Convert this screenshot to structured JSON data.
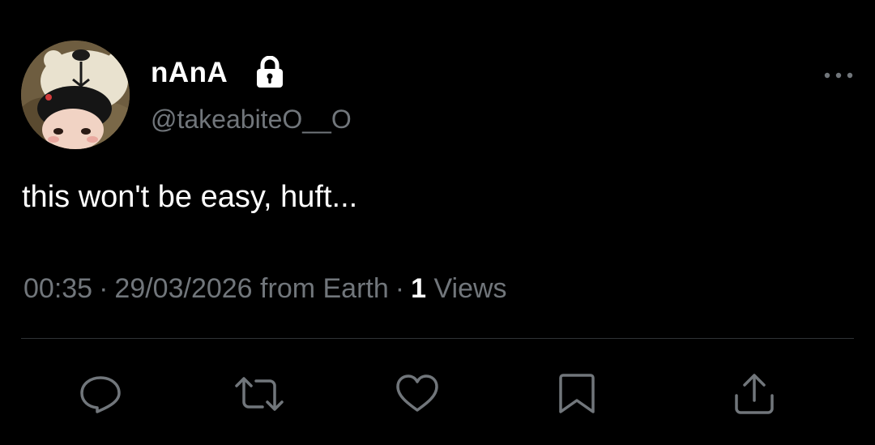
{
  "author": {
    "display_name": "nAnA",
    "handle": "@takeabiteO__O",
    "protected": true,
    "lock_icon": "lock-icon",
    "avatar_icon": "avatar"
  },
  "menu": {
    "icon": "more-horizontal-icon"
  },
  "tweet": {
    "text": "this won't be easy, huft...",
    "time": "00:35",
    "separator": "·",
    "date": "29/03/2026",
    "source": "from Earth",
    "views_count": "1",
    "views_label": "Views"
  },
  "actions": [
    {
      "name": "reply",
      "icon": "reply-icon"
    },
    {
      "name": "retweet",
      "icon": "retweet-icon"
    },
    {
      "name": "like",
      "icon": "heart-icon"
    },
    {
      "name": "bookmark",
      "icon": "bookmark-icon"
    },
    {
      "name": "share",
      "icon": "share-icon"
    }
  ],
  "colors": {
    "background": "#000000",
    "primary_text": "#ffffff",
    "secondary_text": "#71767b",
    "divider": "#2f3336"
  }
}
